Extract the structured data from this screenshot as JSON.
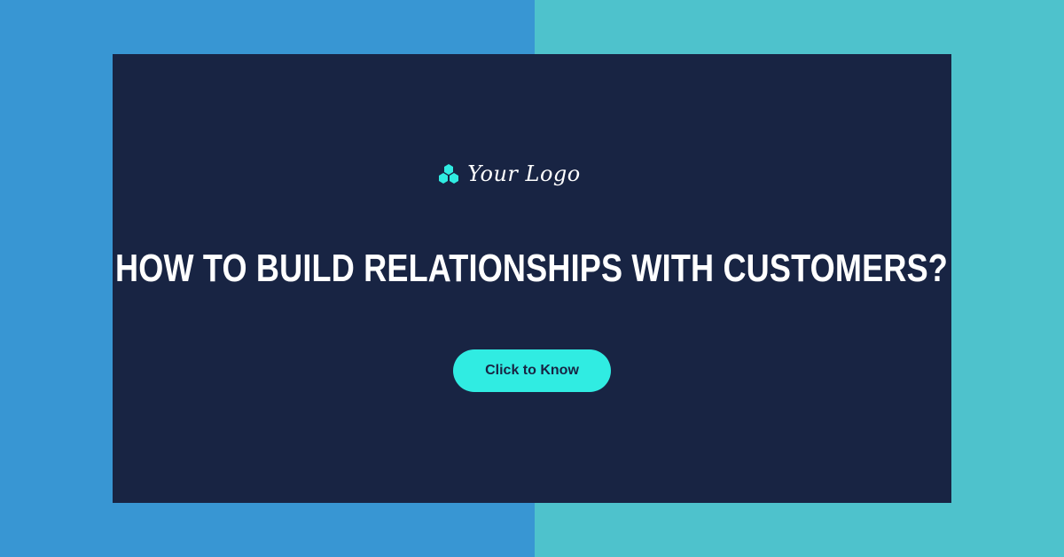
{
  "logo": {
    "text": "Your Logo",
    "icon": "hexagon-cluster-icon"
  },
  "headline": "HOW TO BUILD RELATIONSHIPS WITH CUSTOMERS?",
  "cta": {
    "label": "Click to Know"
  },
  "colors": {
    "background_left": "#3896d3",
    "background_right": "#4ec2cc",
    "panel": "#182443",
    "accent": "#30ece2",
    "text": "#ffffff"
  }
}
